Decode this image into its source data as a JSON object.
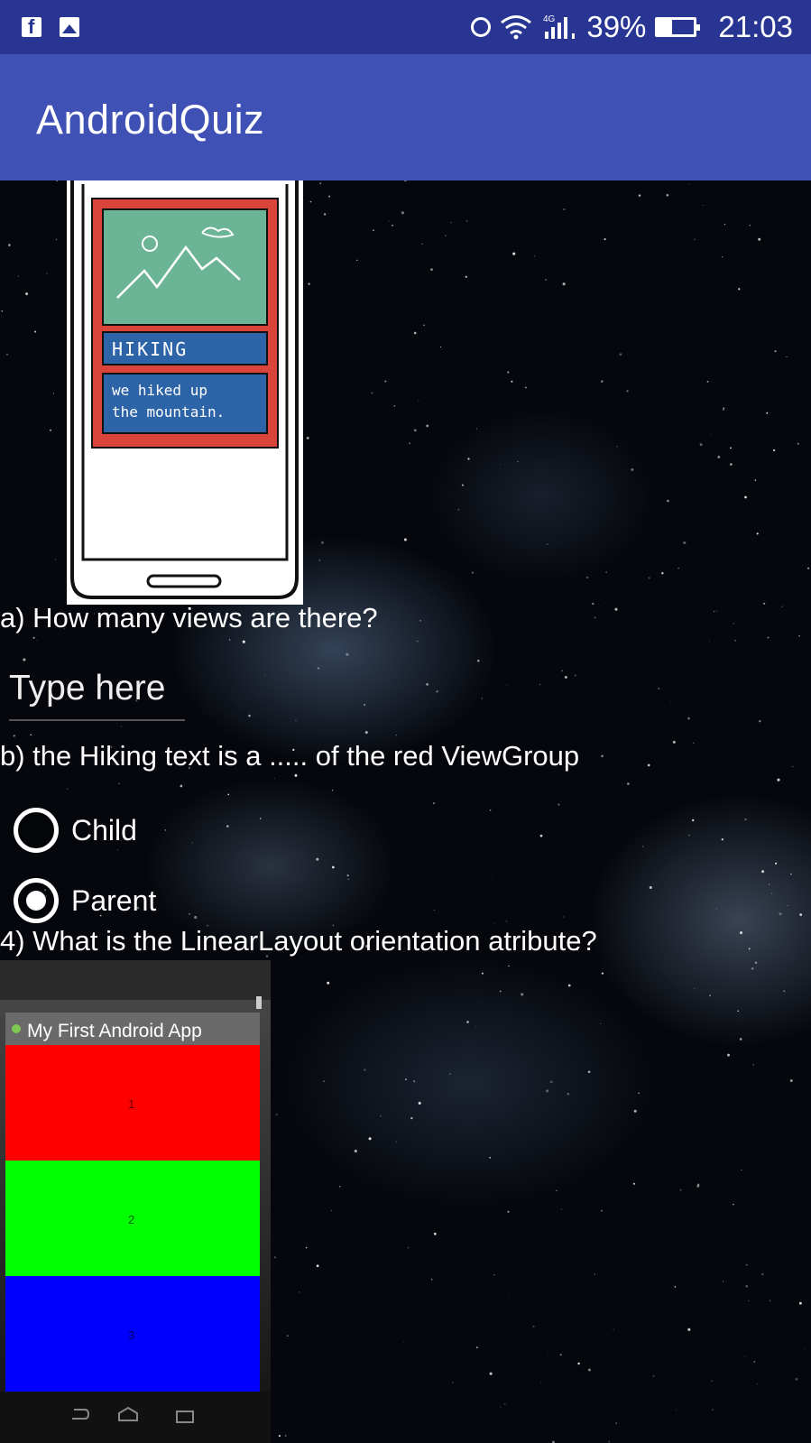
{
  "status_bar": {
    "network_label": "4G",
    "battery_percent": "39%",
    "battery_level": 0.39,
    "time": "21:03",
    "icons": [
      "facebook-icon",
      "gallery-icon",
      "alarm-icon",
      "wifi-icon",
      "signal-icon",
      "battery-icon"
    ]
  },
  "app_bar": {
    "title": "AndroidQuiz"
  },
  "image1": {
    "heading_text": "HIKING",
    "body_text_line1": "we hiked up",
    "body_text_line2": "the mountain."
  },
  "question_a": {
    "text": "a) How many views are there?",
    "input_placeholder": "Type here"
  },
  "question_b": {
    "text": "b) the Hiking text is a ..... of the red ViewGroup",
    "options": [
      {
        "label": "Child",
        "checked": false
      },
      {
        "label": "Parent",
        "checked": true
      }
    ]
  },
  "question_4": {
    "text": "4) What is the LinearLayout orientation atribute?"
  },
  "image2": {
    "app_title": "My First Android App",
    "blocks": [
      {
        "label": "1",
        "color": "#ff0000"
      },
      {
        "label": "2",
        "color": "#00ff00"
      },
      {
        "label": "3",
        "color": "#0000ff"
      }
    ]
  },
  "colors": {
    "status_bar": "#283593",
    "app_bar": "#3f51b5"
  }
}
